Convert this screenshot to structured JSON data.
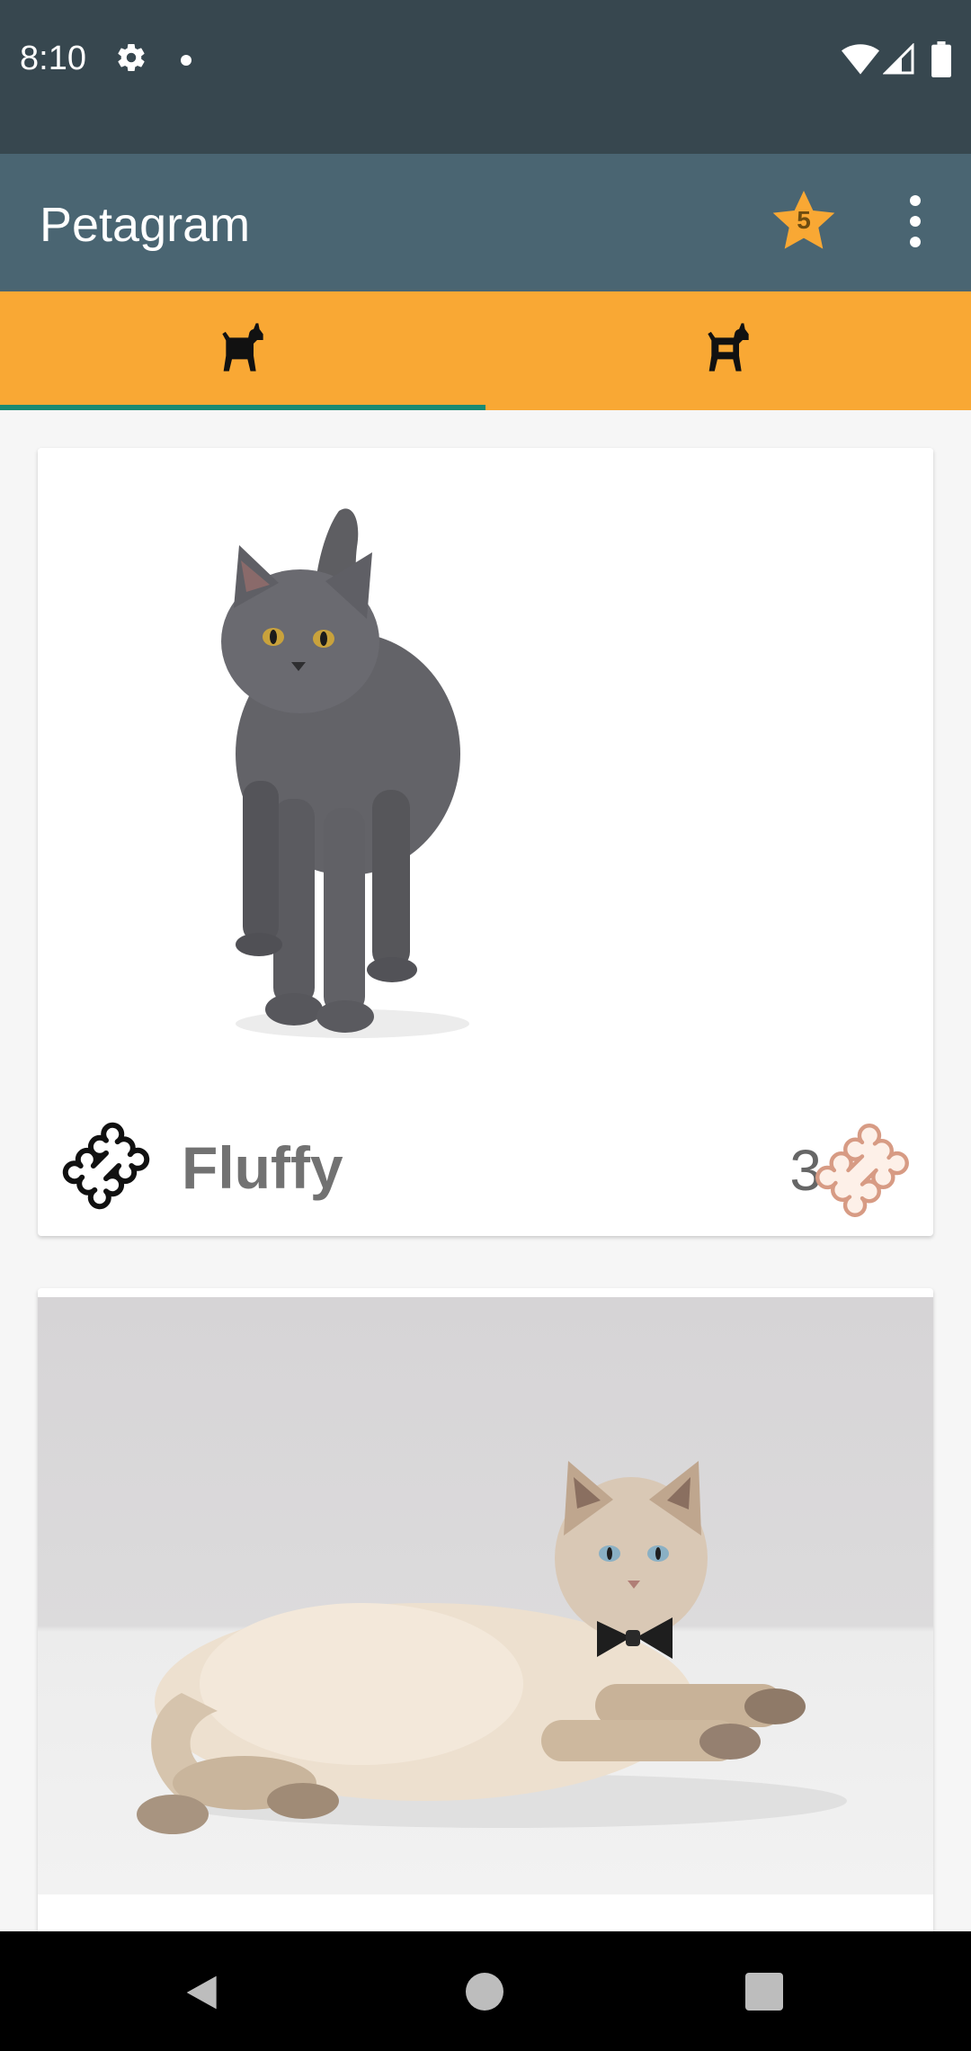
{
  "status_bar": {
    "time": "8:10",
    "icons": [
      "gear-icon",
      "notification-dot-icon",
      "wifi-icon",
      "signal-icon",
      "battery-icon"
    ]
  },
  "app_bar": {
    "title": "Petagram",
    "favorites_count": "5",
    "icons": [
      "star-icon",
      "more-vert-icon"
    ],
    "color": "#4a6572"
  },
  "tabs": {
    "items": [
      {
        "icon": "dog-icon",
        "selected": true
      },
      {
        "icon": "dog-house-icon",
        "selected": false
      }
    ],
    "background": "#f9a834",
    "indicator_color": "#1a8a72"
  },
  "pets": [
    {
      "name": "Fluffy",
      "likes": "3",
      "photo": "gray-cat-standing"
    },
    {
      "name": "",
      "likes": "",
      "photo": "long-haired-cat-with-bow-tie"
    }
  ],
  "nav_bar": {
    "icons": [
      "back-icon",
      "home-icon",
      "recents-icon"
    ]
  }
}
